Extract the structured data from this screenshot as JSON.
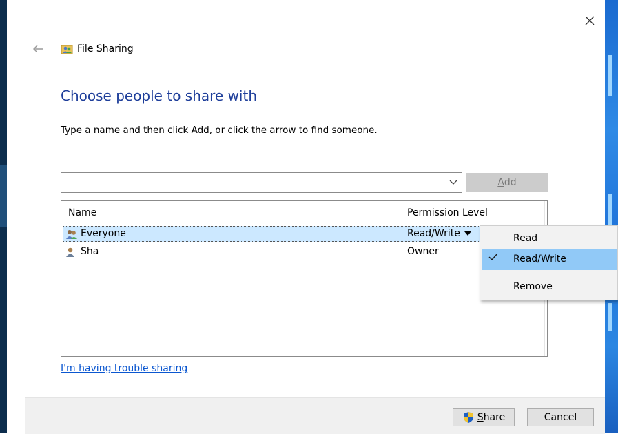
{
  "dialog": {
    "title": "File Sharing",
    "heading": "Choose people to share with",
    "instruction": "Type a name and then click Add, or click the arrow to find someone."
  },
  "name_input": {
    "value": "",
    "placeholder": ""
  },
  "add_button": {
    "label": "Add",
    "accelerator": "A",
    "rest": "dd"
  },
  "list": {
    "headers": {
      "name": "Name",
      "permission": "Permission Level"
    },
    "rows": [
      {
        "name": "Everyone",
        "permission": "Read/Write",
        "icon": "group-icon",
        "selected": true
      },
      {
        "name": "Sha",
        "permission": "Owner",
        "icon": "user-icon",
        "selected": false
      }
    ]
  },
  "context_menu": {
    "items": [
      {
        "label": "Read",
        "checked": false
      },
      {
        "label": "Read/Write",
        "checked": true
      },
      {
        "label": "Remove",
        "checked": false
      }
    ]
  },
  "trouble_link": "I'm having trouble sharing",
  "buttons": {
    "share": {
      "accelerator": "S",
      "rest": "hare",
      "icon": "uac-shield-icon"
    },
    "cancel": "Cancel"
  },
  "colors": {
    "heading": "#1e3e9a",
    "link": "#0b57d0",
    "selection": "#cce8ff",
    "menu_highlight": "#91c9f7"
  }
}
